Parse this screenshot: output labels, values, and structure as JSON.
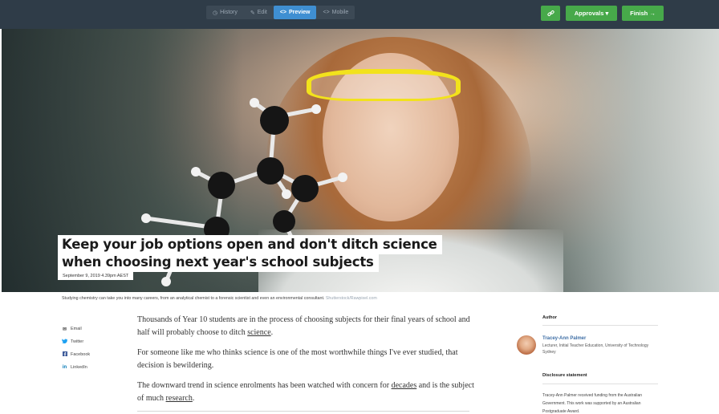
{
  "toolbar": {
    "modes": [
      {
        "icon": "clock-icon",
        "glyph": "◷",
        "label": "History",
        "active": false
      },
      {
        "icon": "pencil-icon",
        "glyph": "✎",
        "label": "Edit",
        "active": false
      },
      {
        "icon": "code-icon",
        "glyph": "<>",
        "label": "Preview",
        "active": true
      },
      {
        "icon": "code-icon",
        "glyph": "<>",
        "label": "Mobile",
        "active": false
      }
    ],
    "link_icon": "link-icon",
    "approvals_label": "Approvals ▾",
    "finish_label": "Finish →",
    "accent": "#47a94a",
    "active_mode_color": "#3f8fd2"
  },
  "hero": {
    "headline_line1": "Keep your job options open and don't ditch science",
    "headline_line2": "when choosing next year's school subjects",
    "date": "September 9, 2019 4.39pm AEST",
    "caption": "Studying chemistry can take you into many careers, from an analytical chemist to a forensic scientist and even an environmental consultant.",
    "caption_credit": "Shutterstock/Rawpixel.com"
  },
  "share": [
    {
      "icon": "mail-icon",
      "glyph": "✉",
      "label": "Email"
    },
    {
      "icon": "twitter-icon",
      "glyph": "🐦",
      "label": "Twitter"
    },
    {
      "icon": "facebook-icon",
      "glyph": "f",
      "label": "Facebook"
    },
    {
      "icon": "linkedin-icon",
      "glyph": "in",
      "label": "LinkedIn"
    }
  ],
  "article": {
    "p1_before": "Thousands of Year 10 students are in the process of choosing subjects for their final years of school and half will probably choose to ditch ",
    "p1_link": "science",
    "p1_after": ".",
    "p2": "For someone like me who thinks science is one of the most worthwhile things I've ever studied, that decision is bewildering.",
    "p3_before": "The downward trend in science enrolments has been watched with concern for ",
    "p3_link1": "decades",
    "p3_mid": " and is the subject of much ",
    "p3_link2": "research",
    "p3_after": "."
  },
  "sidebar": {
    "author_heading": "Author",
    "author_name": "Tracey-Ann Palmer",
    "author_role": "Lecturer, Initial Teacher Education, University of Technology Sydney",
    "disclosure_heading": "Disclosure statement",
    "disclosure_text": "Tracey-Ann Palmer received funding from the Australian Government. This work was supported by an Australian Postgraduate Award."
  }
}
